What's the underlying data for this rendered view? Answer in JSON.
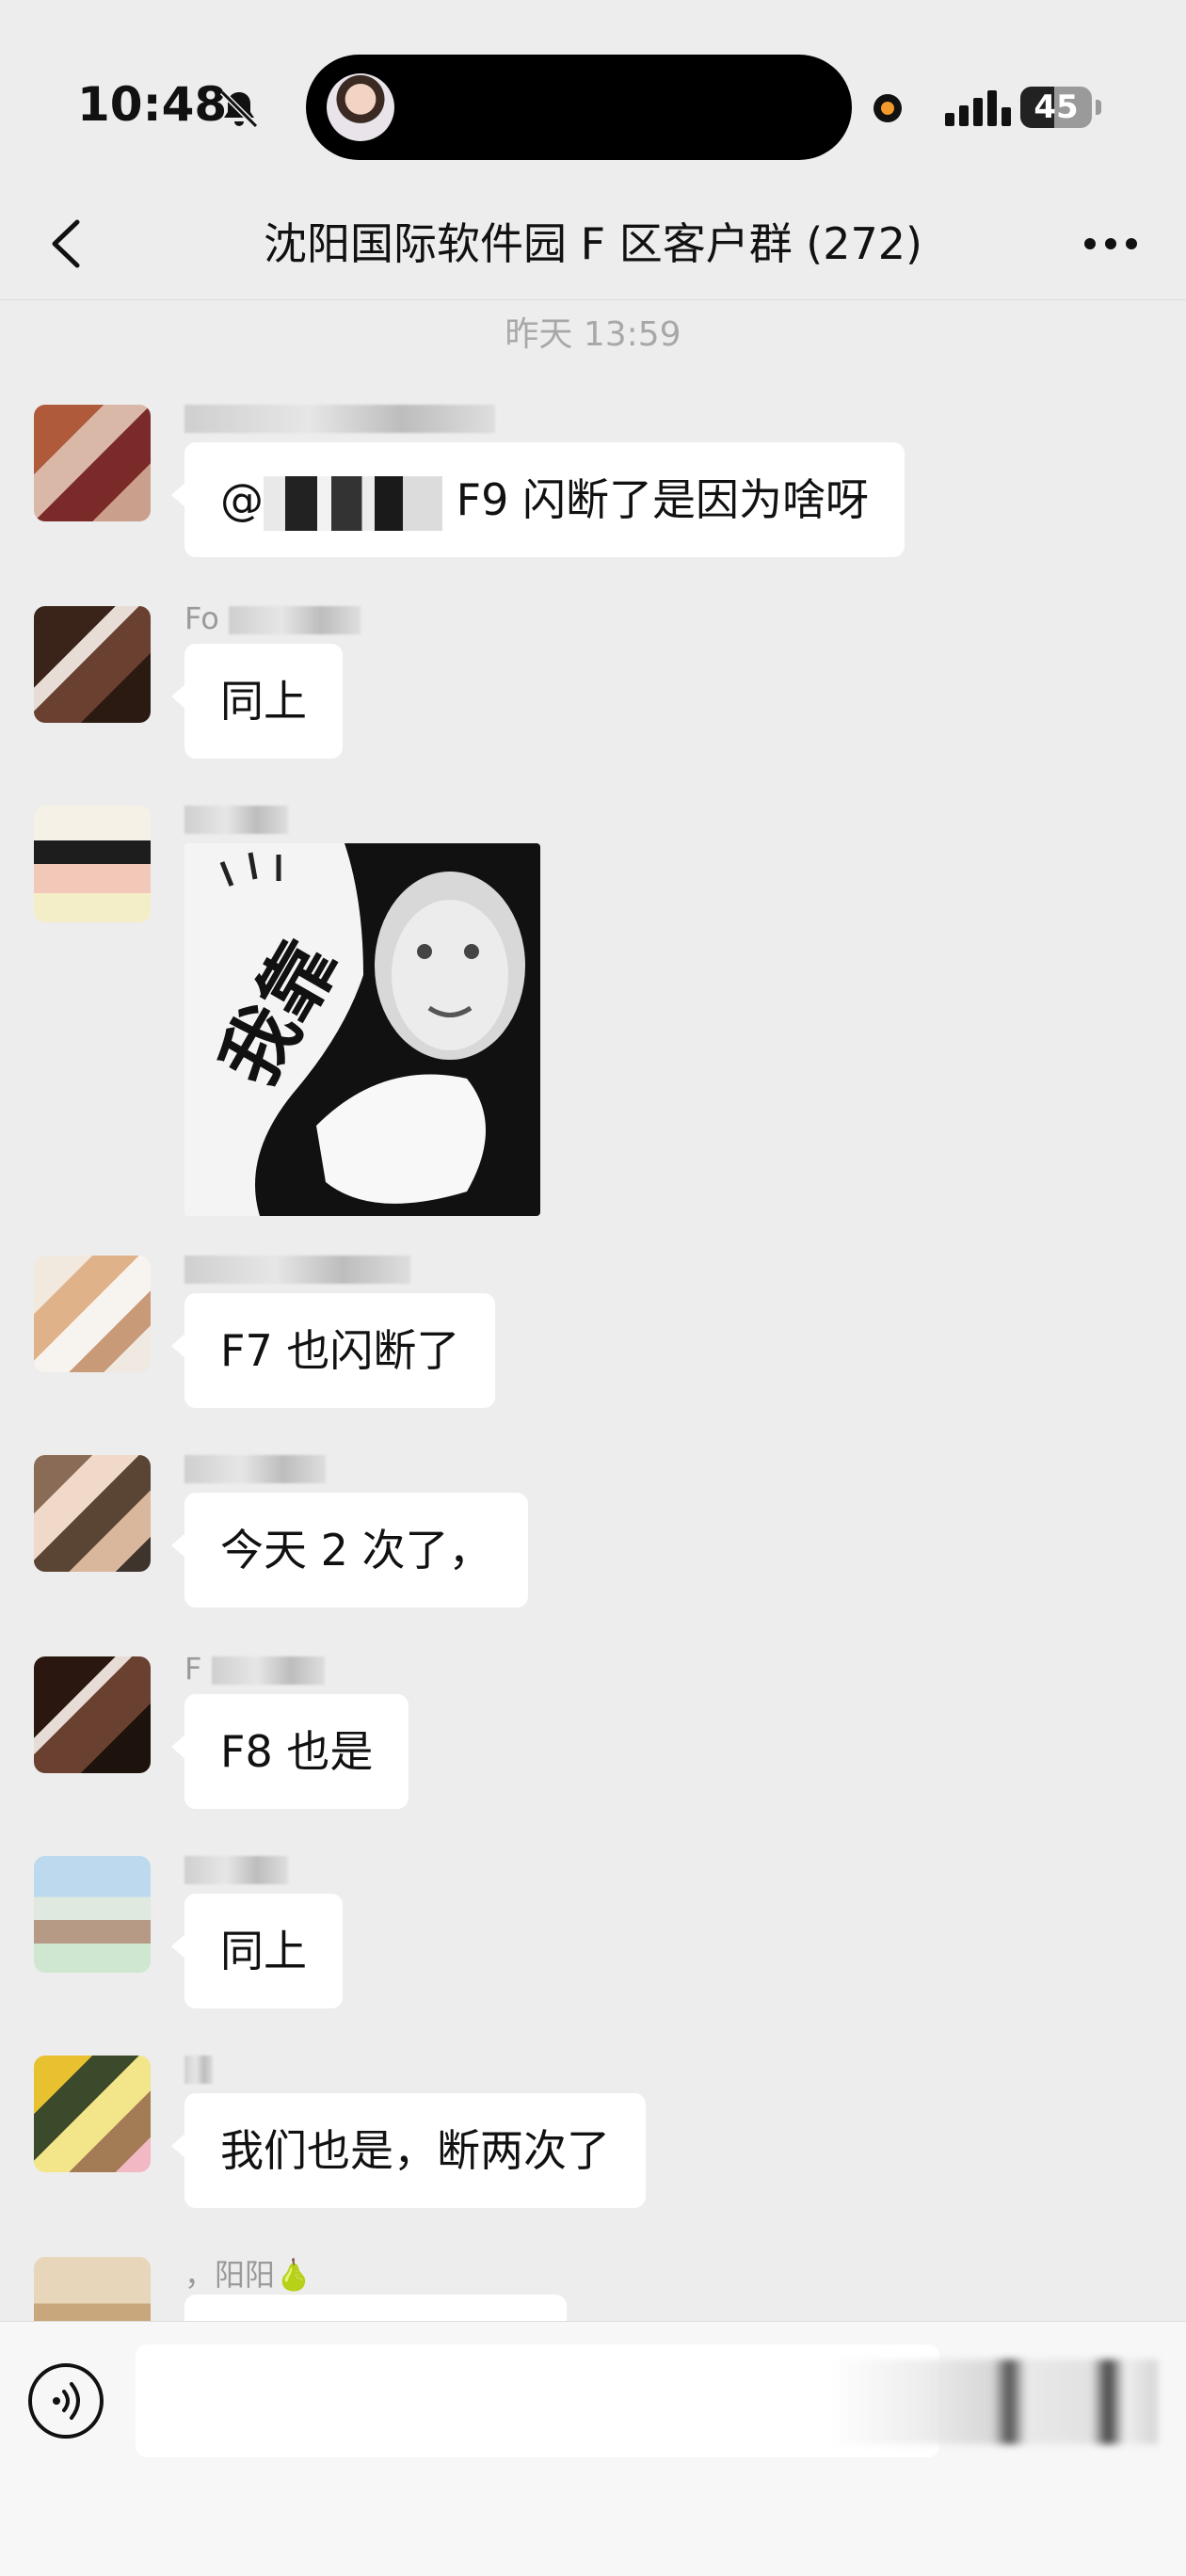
{
  "status_bar": {
    "time": "10:48",
    "battery": "45"
  },
  "nav": {
    "title": "沈阳国际软件园 F 区客户群 (272)"
  },
  "chat": {
    "timestamp": "昨天 13:59",
    "messages": [
      {
        "sender": "",
        "text_prefix": "@",
        "text": "F9 闪断了是因为啥呀",
        "avatar": "avatar-1"
      },
      {
        "sender": "Fo",
        "text": "同上",
        "avatar": "avatar-2"
      },
      {
        "sender": "",
        "sticker_text": "我靠",
        "avatar": "avatar-3"
      },
      {
        "sender": "",
        "text": "F7 也闪断了",
        "avatar": "avatar-4"
      },
      {
        "sender": "",
        "text": "今天 2 次了，",
        "avatar": "avatar-5"
      },
      {
        "sender": "F",
        "text": "F8 也是",
        "avatar": "avatar-6"
      },
      {
        "sender": "",
        "text": "同上",
        "avatar": "avatar-7"
      },
      {
        "sender": "",
        "text": "我们也是，断两次了",
        "avatar": "avatar-8"
      },
      {
        "sender": "，阳阳🍐",
        "text": "",
        "avatar": "avatar-9"
      }
    ]
  },
  "colors": {
    "background": "#ededed",
    "bubble": "#ffffff",
    "text": "#111111",
    "meta": "#a8a8a8"
  },
  "icons": {
    "back": "chevron-left-icon",
    "more": "more-dots-icon",
    "voice": "voice-icon",
    "mute": "bell-slash-icon"
  }
}
